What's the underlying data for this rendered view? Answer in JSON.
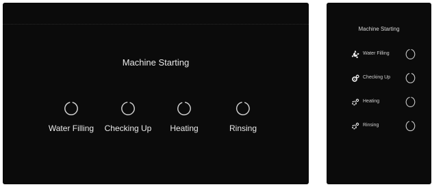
{
  "wide": {
    "title": "Machine Starting",
    "steps": [
      {
        "label": "Water Filling"
      },
      {
        "label": "Checking Up"
      },
      {
        "label": "Heating"
      },
      {
        "label": "Rinsing"
      }
    ]
  },
  "narrow": {
    "title": "Machine Starting",
    "steps": [
      {
        "label": "Water Filling",
        "icon": "water-filling-icon"
      },
      {
        "label": "Checking Up",
        "icon": "checking-up-icon"
      },
      {
        "label": "Heating",
        "icon": "heating-icon"
      },
      {
        "label": "Rinsing",
        "icon": "rinsing-icon"
      }
    ]
  },
  "colors": {
    "background": "#0b0b0b",
    "text": "#eaeaea",
    "spinner": "#cfcfcf"
  }
}
